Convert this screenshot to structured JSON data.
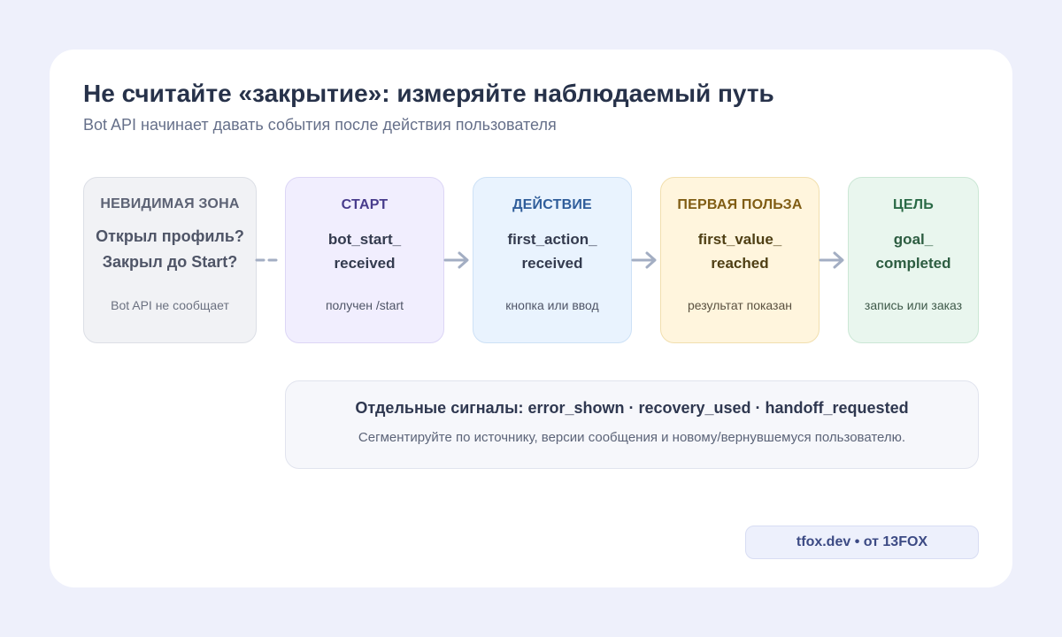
{
  "header": {
    "title": "Не считайте «закрытие»: измеряйте наблюдаемый путь",
    "subtitle": "Bot API начинает давать события после действия пользователя"
  },
  "stages": [
    {
      "label": "НЕВИДИМАЯ ЗОНА",
      "event_lines": [
        "Открыл профиль?",
        "Закрыл до Start?"
      ],
      "note": "Bot API не сообщает"
    },
    {
      "label": "СТАРТ",
      "event_lines": [
        "bot_start_",
        "received"
      ],
      "note": "получен /start"
    },
    {
      "label": "ДЕЙСТВИЕ",
      "event_lines": [
        "first_action_",
        "received"
      ],
      "note": "кнопка или ввод"
    },
    {
      "label": "ПЕРВАЯ ПОЛЬЗА",
      "event_lines": [
        "first_value_",
        "reached"
      ],
      "note": "результат показан"
    },
    {
      "label": "ЦЕЛЬ",
      "event_lines": [
        "goal_",
        "completed"
      ],
      "note": "запись или заказ"
    }
  ],
  "signals": {
    "headline": "Отдельные сигналы: error_shown · recovery_used · handoff_requested",
    "description": "Сегментируйте по источнику, версии сообщения и новому/вернувшемуся пользователю."
  },
  "brand": {
    "text": "tfox.dev • от 13FOX"
  },
  "colors": {
    "background": "#eef0fb",
    "card": "#ffffff",
    "title": "#27324a",
    "invisible_zone": "#f1f2f5",
    "start": "#f1eefe",
    "action": "#e9f3fe",
    "value": "#fff5dd",
    "goal": "#e9f6ee",
    "arrow": "#a3aec3"
  },
  "connectors": [
    {
      "from": "invisible",
      "to": "start",
      "style": "dashed"
    },
    {
      "from": "start",
      "to": "action",
      "style": "arrow"
    },
    {
      "from": "action",
      "to": "value",
      "style": "arrow"
    },
    {
      "from": "value",
      "to": "goal",
      "style": "arrow"
    }
  ]
}
